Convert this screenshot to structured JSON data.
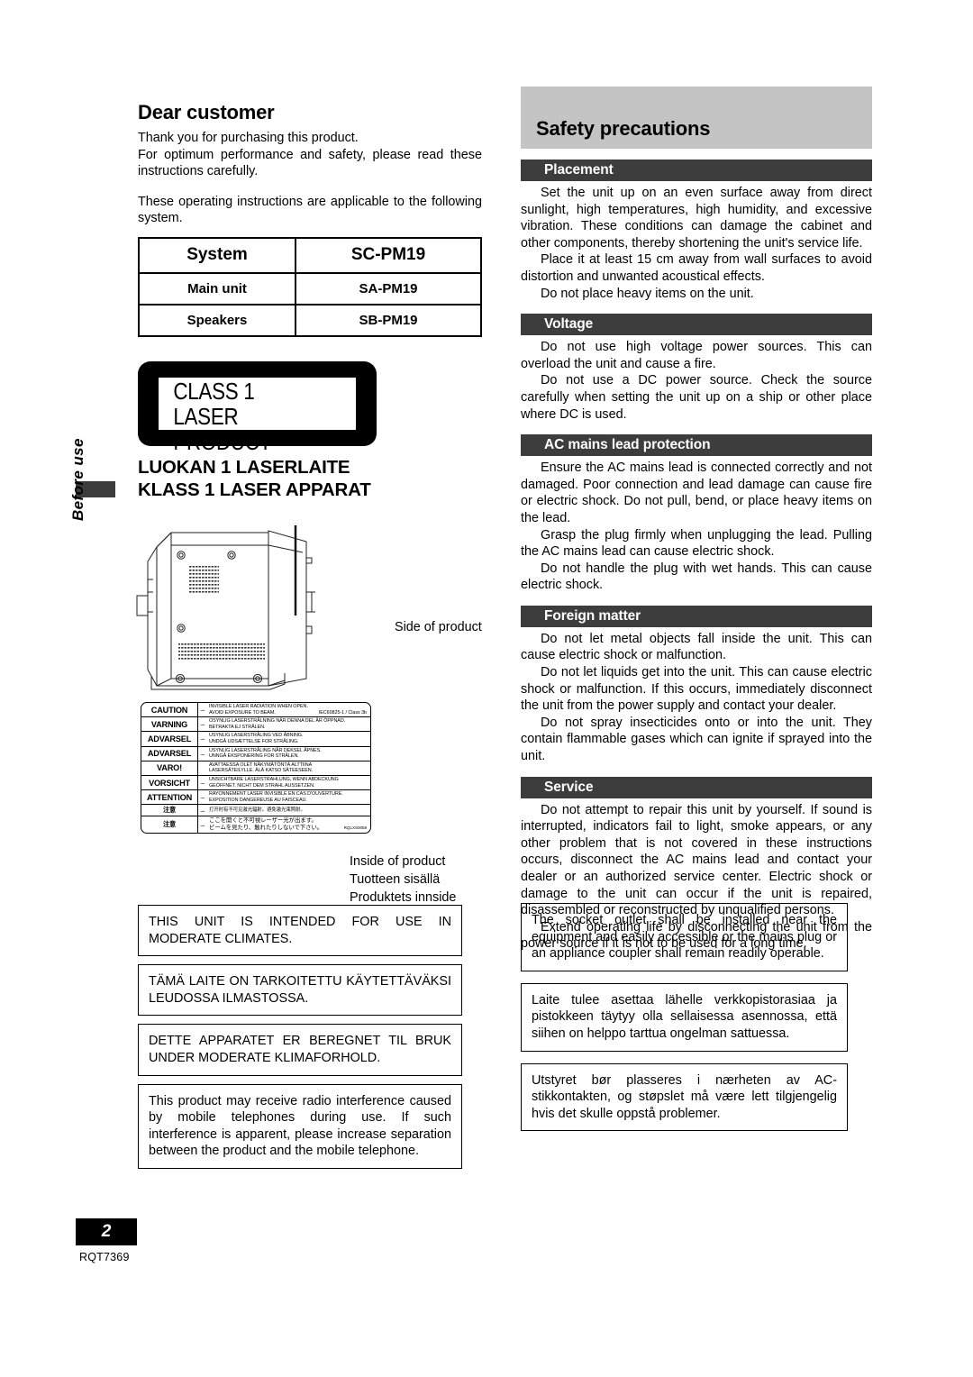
{
  "side_tab": {
    "label": "Before use"
  },
  "left": {
    "dear_title": "Dear customer",
    "intro_1": "Thank you for purchasing this product.",
    "intro_2": "For optimum performance and safety, please read these instructions carefully.",
    "intro_3": "These operating instructions are applicable to the following system.",
    "system_table": {
      "header": {
        "label": "System",
        "value": "SC-PM19"
      },
      "rows": [
        {
          "label": "Main unit",
          "value": "SA-PM19"
        },
        {
          "label": "Speakers",
          "value": "SB-PM19"
        }
      ]
    },
    "laser_badge": {
      "line1": "CLASS 1",
      "line2": "LASER PRODUCT"
    },
    "luokan_line1": "LUOKAN 1 LASERLAITE",
    "luokan_line2": "KLASS 1 LASER APPARAT",
    "side_of_product": "Side of product",
    "inside_captions": {
      "en": "Inside of product",
      "fi": "Tuotteen sisällä",
      "no": "Produktets innside"
    },
    "caution_label": {
      "rows": [
        {
          "lang": "CAUTION",
          "dash": "–",
          "line1": "INVISIBLE LASER RADIATION WHEN OPEN.",
          "line2": "AVOID EXPOSURE TO BEAM.",
          "note": "IEC60825-1 / Class 3b"
        },
        {
          "lang": "VARNING",
          "dash": "–",
          "line1": "OSYNLIG LASERSTRÅLNING NÄR DENNA DEL ÄR ÖPPNAD.",
          "line2": "BETRAKTA EJ STRÅLEN.",
          "note": ""
        },
        {
          "lang": "ADVARSEL",
          "dash": "–",
          "line1": "USYNLIG LASERSTRÅLING VED ÅBNING.",
          "line2": "UNDGÅ UDSÆTTELSE FOR STRÅLING.",
          "note": ""
        },
        {
          "lang": "ADVARSEL",
          "dash": "–",
          "line1": "USYNLIG LASERSTRÅLING NÅR DEKSEL ÅPNES.",
          "line2": "UNNGÅ EKSPONERING FOR STRÅLEN.",
          "note": ""
        },
        {
          "lang": "VARO!",
          "dash": "",
          "line1": "AVATTAESSA OLET NÄKYMÄTÖNTÄ  ALTTIINA",
          "line2": "LASERSÄTEILYLLE.    ÄLÄ KATSO SÄTEESEEN.",
          "note": ""
        },
        {
          "lang": "VORSICHT",
          "dash": "–",
          "line1": "UNSICHTBARE LASERSTRAHLUNG, WENN ABDECKUNG",
          "line2": "GEÖFFNET.    NICHT DEM STRAHL AUSSETZEN.",
          "note": ""
        },
        {
          "lang": "ATTENTION",
          "dash": "–",
          "line1": "RAYONNEMENT LASER INVISIBLE EN CAS D'OUVERTURE.",
          "line2": "EXPOSITION DANGEREUSE AU FAISCEAU.",
          "note": ""
        },
        {
          "lang": "注意",
          "dash": "–",
          "line1": "打开时有不可见激光辐射。避免激光束照射。",
          "line2": "",
          "note": ""
        },
        {
          "lang": "注意",
          "dash": "–",
          "line1": "ここを開くと不可視レーザー光が出ます。",
          "line2": "ビームを見たり、触れたりしないで下さい。",
          "note": "RQLXS0058"
        }
      ]
    },
    "notices": [
      "THIS UNIT IS INTENDED FOR USE IN MODERATE CLIMATES.",
      "TÄMÄ LAITE ON TARKOITETTU KÄYTETTÄVÄKSI LEUDOSSA ILMASTOSSA.",
      "DETTE APPARATET ER BEREGNET TIL BRUK UNDER MODERATE KLIMAFORHOLD.",
      "This product may receive radio interference caused by mobile telephones during use. If such interference is apparent, please increase separation between the product and the mobile telephone."
    ]
  },
  "right": {
    "banner_title": "Safety precautions",
    "sections": [
      {
        "heading": "Placement",
        "paragraphs": [
          "Set the unit up on an even surface away from direct sunlight, high temperatures, high humidity, and excessive vibration. These conditions can damage the cabinet and other components, thereby shortening the unit's service life.",
          "Place it at least 15 cm away from wall surfaces to avoid distortion and unwanted acoustical effects.",
          "Do not place heavy items on the unit."
        ]
      },
      {
        "heading": "Voltage",
        "paragraphs": [
          "Do not use high voltage power sources. This can overload the unit and cause a fire.",
          "Do not use a DC power source. Check the source carefully when setting the unit up on a ship or other place where DC is used."
        ]
      },
      {
        "heading": "AC mains lead protection",
        "paragraphs": [
          "Ensure the AC mains lead is connected correctly and not damaged. Poor connection and lead damage can cause fire or electric shock. Do not pull, bend, or place heavy items on the lead.",
          "Grasp the plug firmly when unplugging the lead. Pulling the AC mains lead can cause electric shock.",
          "Do not handle the plug with wet hands. This can cause electric shock."
        ]
      },
      {
        "heading": "Foreign matter",
        "paragraphs": [
          "Do not let metal objects fall inside the unit. This can cause electric shock or malfunction.",
          "Do not let liquids get into the unit. This can cause electric shock or malfunction. If this occurs, immediately disconnect the unit from the power supply and contact your dealer.",
          "Do not spray insecticides onto or into the unit. They contain flammable gases which can ignite if sprayed into the unit."
        ]
      },
      {
        "heading": "Service",
        "paragraphs": [
          "Do not attempt to repair this unit by yourself. If sound is interrupted, indicators fail to light, smoke appears, or any other problem that is not covered in these instructions occurs, disconnect the AC mains lead and contact your dealer or an authorized service center. Electric shock or damage to the unit can occur if the unit is repaired, disassembled or reconstructed by unqualified persons.",
          "Extend operating life by disconnecting the unit from the power source if it is not to be used for a long time."
        ]
      }
    ],
    "notices": [
      "The socket outlet shall be installed near the equipment and easily accessible or the mains plug or an appliance coupler shall remain readily operable.",
      "Laite tulee asettaa lähelle verkkopistorasiaa ja pistokkeen täytyy olla sellaisessa asennossa, että siihen on helppo tarttua ongelman sattuessa.",
      "Utstyret bør plasseres i nærheten av AC-stikkontakten, og støpslet må være lett tilgjengelig hvis det skulle oppstå problemer."
    ]
  },
  "footer": {
    "page_number": "2",
    "doc_code": "RQT7369"
  },
  "colors": {
    "banner_gray": "#c4c4c4",
    "section_header_gray": "#3d3d3d",
    "black": "#000000"
  }
}
